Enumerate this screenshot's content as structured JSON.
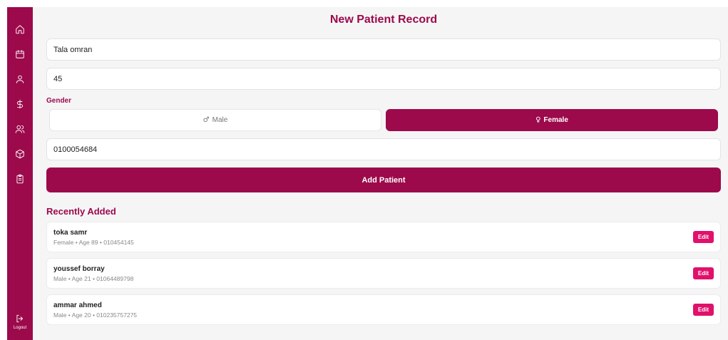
{
  "sidebar": {
    "items": [
      {
        "icon": "home-icon"
      },
      {
        "icon": "calendar-icon"
      },
      {
        "icon": "user-icon"
      },
      {
        "icon": "dollar-icon"
      },
      {
        "icon": "users-icon"
      },
      {
        "icon": "package-icon"
      },
      {
        "icon": "clipboard-icon"
      }
    ],
    "logout_label": "Logout"
  },
  "page_title": "New Patient Record",
  "form": {
    "name_value": "Tala omran",
    "age_value": "45",
    "gender_label": "Gender",
    "gender_options": [
      {
        "symbol": "♂",
        "label": "Male",
        "selected": false
      },
      {
        "symbol": "♀",
        "label": "Female",
        "selected": true
      }
    ],
    "phone_value": "0100054684",
    "submit_label": "Add Patient"
  },
  "recent": {
    "title": "Recently Added",
    "edit_label": "Edit",
    "patients": [
      {
        "name": "toka samr",
        "meta": "Female • Age 89 • 010454145"
      },
      {
        "name": "youssef borray",
        "meta": "Male • Age 21 • 01064489798"
      },
      {
        "name": "ammar ahmed",
        "meta": "Male • Age 20 • 010235757275"
      }
    ]
  },
  "colors": {
    "accent": "#9c0a4c",
    "edit": "#e0116b",
    "background": "#f5f5f6"
  }
}
